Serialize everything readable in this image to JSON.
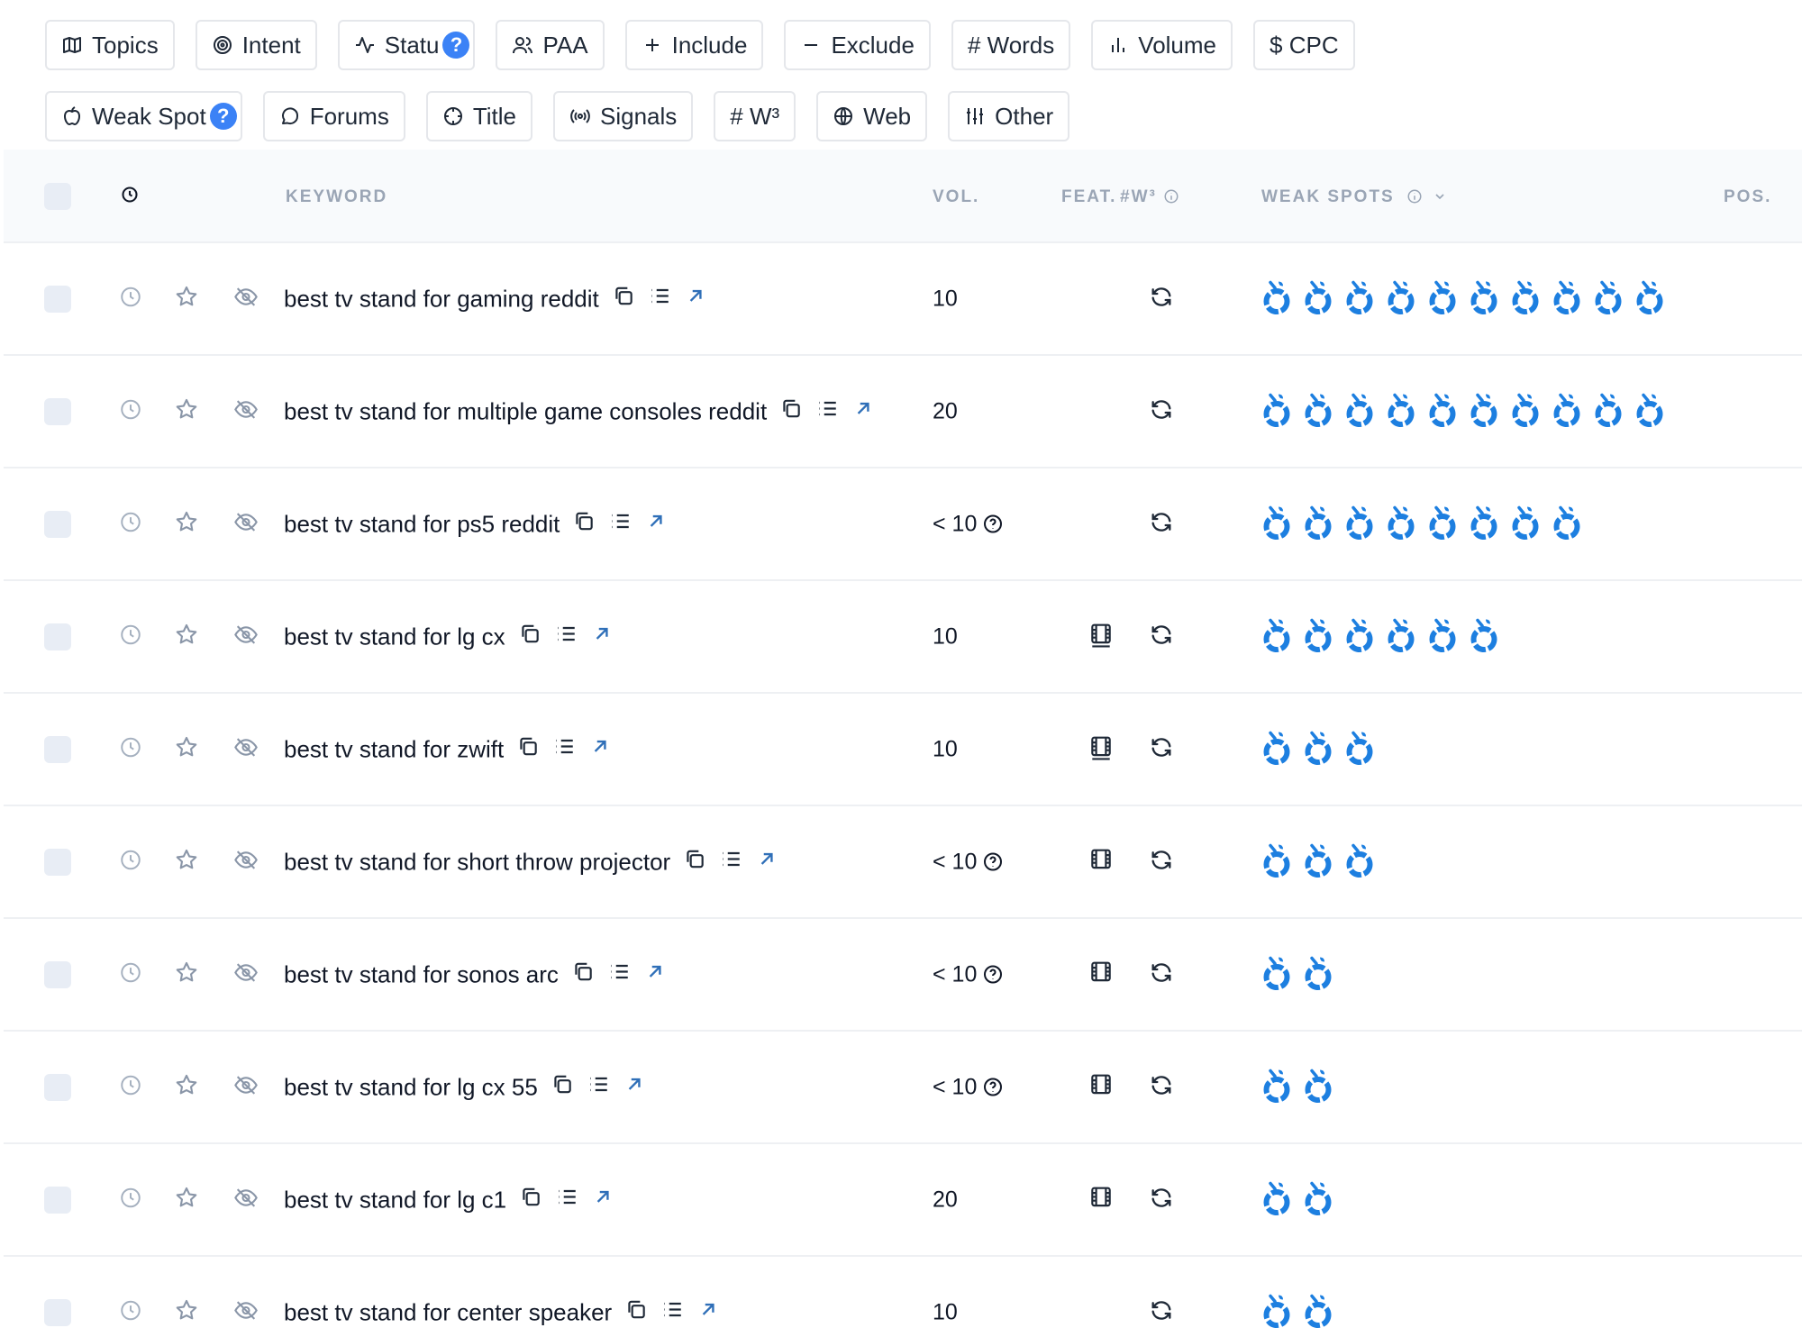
{
  "filters": {
    "row1": [
      {
        "label": "Topics",
        "icon": "map-icon"
      },
      {
        "label": "Intent",
        "icon": "target-icon"
      },
      {
        "label": "Statu",
        "icon": "activity-icon",
        "badge": "?"
      },
      {
        "label": "PAA",
        "icon": "users-icon"
      },
      {
        "label": "Include",
        "icon": "plus-icon"
      },
      {
        "label": "Exclude",
        "icon": "minus-icon"
      },
      {
        "label": "# Words",
        "icon": ""
      },
      {
        "label": "Volume",
        "icon": "bar-chart-icon"
      },
      {
        "label": "$ CPC",
        "icon": ""
      }
    ],
    "row2": [
      {
        "label": "Weak Spot",
        "icon": "apple-icon",
        "badge": "?"
      },
      {
        "label": "Forums",
        "icon": "message-icon"
      },
      {
        "label": "Title",
        "icon": "crosshair-icon"
      },
      {
        "label": "Signals",
        "icon": "radio-icon"
      },
      {
        "label": "# W³",
        "icon": ""
      },
      {
        "label": "Web",
        "icon": "globe-icon"
      },
      {
        "label": "Other",
        "icon": "sliders-icon"
      }
    ]
  },
  "table": {
    "headers": {
      "keyword": "KEYWORD",
      "vol": "VOL.",
      "feat": "FEAT.",
      "w3": "#W³",
      "weak_spots": "WEAK SPOTS",
      "pos": "POS."
    },
    "rows": [
      {
        "keyword": "best tv stand for gaming reddit",
        "vol": "10",
        "vol_help": false,
        "feat": false,
        "weak_spots": 10
      },
      {
        "keyword": "best tv stand for multiple game consoles reddit",
        "vol": "20",
        "vol_help": false,
        "feat": false,
        "weak_spots": 10
      },
      {
        "keyword": "best tv stand for ps5 reddit",
        "vol": "< 10",
        "vol_help": true,
        "feat": false,
        "weak_spots": 8
      },
      {
        "keyword": "best tv stand for lg cx",
        "vol": "10",
        "vol_help": false,
        "feat": true,
        "weak_spots": 6
      },
      {
        "keyword": "best tv stand for zwift",
        "vol": "10",
        "vol_help": false,
        "feat": true,
        "weak_spots": 3
      },
      {
        "keyword": "best tv stand for short throw projector",
        "vol": "< 10",
        "vol_help": true,
        "feat": true,
        "weak_spots": 3
      },
      {
        "keyword": "best tv stand for sonos arc",
        "vol": "< 10",
        "vol_help": true,
        "feat": true,
        "weak_spots": 2
      },
      {
        "keyword": "best tv stand for lg cx 55",
        "vol": "< 10",
        "vol_help": true,
        "feat": true,
        "weak_spots": 2
      },
      {
        "keyword": "best tv stand for lg c1",
        "vol": "20",
        "vol_help": false,
        "feat": true,
        "weak_spots": 2
      },
      {
        "keyword": "best tv stand for center speaker",
        "vol": "10",
        "vol_help": false,
        "feat": false,
        "weak_spots": 2
      }
    ]
  },
  "colors": {
    "accent": "#3b82f6",
    "weak_spot": "#1d7fe0",
    "header_text": "#9aa5b5"
  }
}
